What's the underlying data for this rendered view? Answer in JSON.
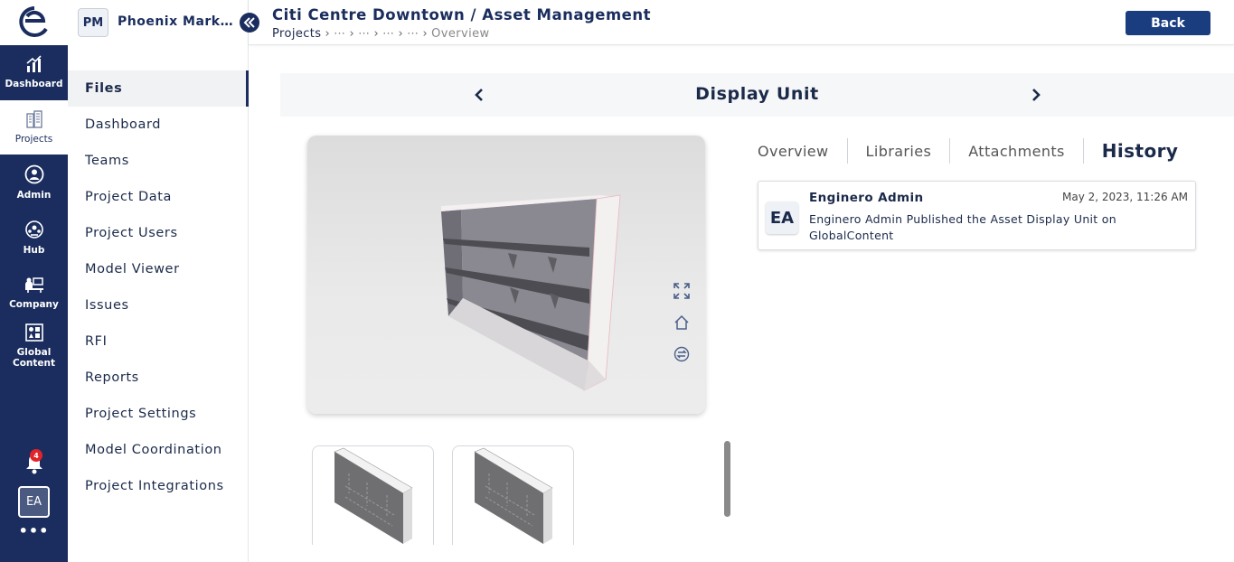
{
  "rail": {
    "items": [
      {
        "label": "Dashboard",
        "icon": "bar-chart-icon"
      },
      {
        "label": "Projects",
        "icon": "buildings-icon"
      },
      {
        "label": "Admin",
        "icon": "admin-user-icon"
      },
      {
        "label": "Hub",
        "icon": "hub-icon"
      },
      {
        "label": "Company",
        "icon": "company-icon"
      },
      {
        "label": "Global Content",
        "icon": "shapes-icon"
      }
    ],
    "notification_count": "4",
    "avatar": "EA",
    "more": "•••"
  },
  "project": {
    "badge": "PM",
    "name": "Phoenix Mark…"
  },
  "subnav": {
    "items": [
      "Files",
      "Dashboard",
      "Teams",
      "Project Data",
      "Project Users",
      "Model Viewer",
      "Issues",
      "RFI",
      "Reports",
      "Project Settings",
      "Model Coordination",
      "Project Integrations"
    ]
  },
  "header": {
    "title": "Citi Centre Downtown / Asset Management",
    "breadcrumbs": [
      "Projects",
      "⋯",
      "⋯",
      "⋯",
      "⋯",
      "Overview"
    ],
    "back_label": "Back"
  },
  "asset": {
    "title": "Display Unit"
  },
  "tabs": [
    "Overview",
    "Libraries",
    "Attachments",
    "History"
  ],
  "history": [
    {
      "avatar": "EA",
      "name": "Enginero Admin",
      "date": "May 2, 2023, 11:26 AM",
      "message": "Enginero Admin Published the Asset Display Unit on GlobalContent"
    }
  ],
  "colors": {
    "primary": "#1a2d5e",
    "button": "#1a3d80",
    "badge": "#e0242a"
  }
}
